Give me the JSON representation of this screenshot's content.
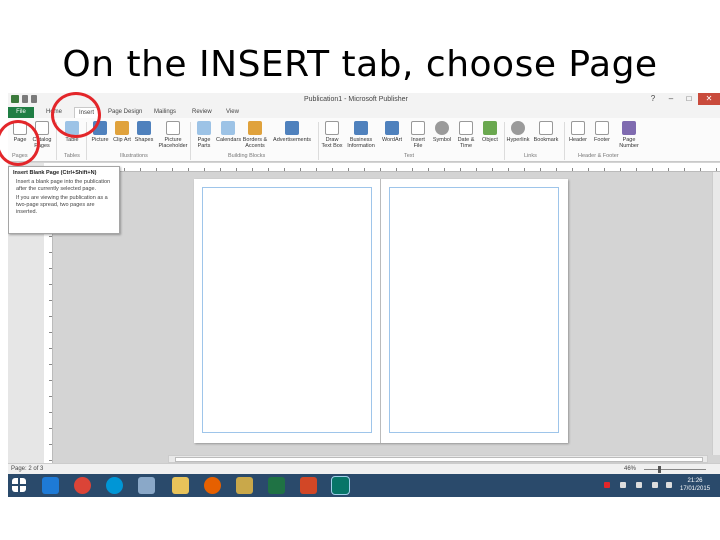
{
  "slide": {
    "title": "On the INSERT tab, choose Page"
  },
  "window": {
    "title": "Publication1 - Microsoft Publisher"
  },
  "ribbon_tabs": {
    "file": "File",
    "insert": "Insert",
    "page_design": "Page Design",
    "mailings": "Mailings",
    "review": "Review",
    "view": "View"
  },
  "ribbon_buttons": {
    "page": "Page",
    "catalog": "Catalog Pages",
    "table": "Table",
    "picture": "Picture",
    "clip_art": "Clip Art",
    "shapes": "Shapes",
    "picture_placeholder": "Picture Placeholder",
    "page_parts": "Page Parts",
    "calendars": "Calendars",
    "borders": "Borders & Accents",
    "advertisements": "Advertisements",
    "draw_text_box": "Draw Text Box",
    "business_info": "Business Information",
    "wordart": "WordArt",
    "insert_file": "Insert File",
    "symbol": "Symbol",
    "date_time": "Date & Time",
    "object": "Object",
    "hyperlink": "Hyperlink",
    "bookmark": "Bookmark",
    "header": "Header",
    "footer": "Footer",
    "page_number": "Page Number"
  },
  "ribbon_groups": {
    "pages": "Pages",
    "tables": "Tables",
    "illustrations": "Illustrations",
    "building_blocks": "Building Blocks",
    "text": "Text",
    "links": "Links",
    "header_footer": "Header & Footer"
  },
  "tooltip": {
    "title": "Insert Blank Page (Ctrl+Shift+N)",
    "line1": "Insert a blank page into the publication after the currently selected page.",
    "line2": "If you are viewing the publication as a two-page spread, two pages are inserted."
  },
  "status": {
    "page": "Page: 2 of 3",
    "zoom": "46%"
  },
  "clock": {
    "time": "21:26",
    "date": "17/01/2015"
  },
  "colors": {
    "annotation": "#e3262a",
    "file_tab": "#1f7e44",
    "taskbar": "#2a4a6b",
    "guide": "#9ec5ea"
  },
  "icons": {
    "taskbar": [
      "start-icon",
      "ie-icon",
      "chrome-icon",
      "hp-icon",
      "files-icon",
      "folder-icon",
      "firefox-icon",
      "paint-icon",
      "excel-icon",
      "powerpoint-icon",
      "publisher-icon"
    ]
  }
}
